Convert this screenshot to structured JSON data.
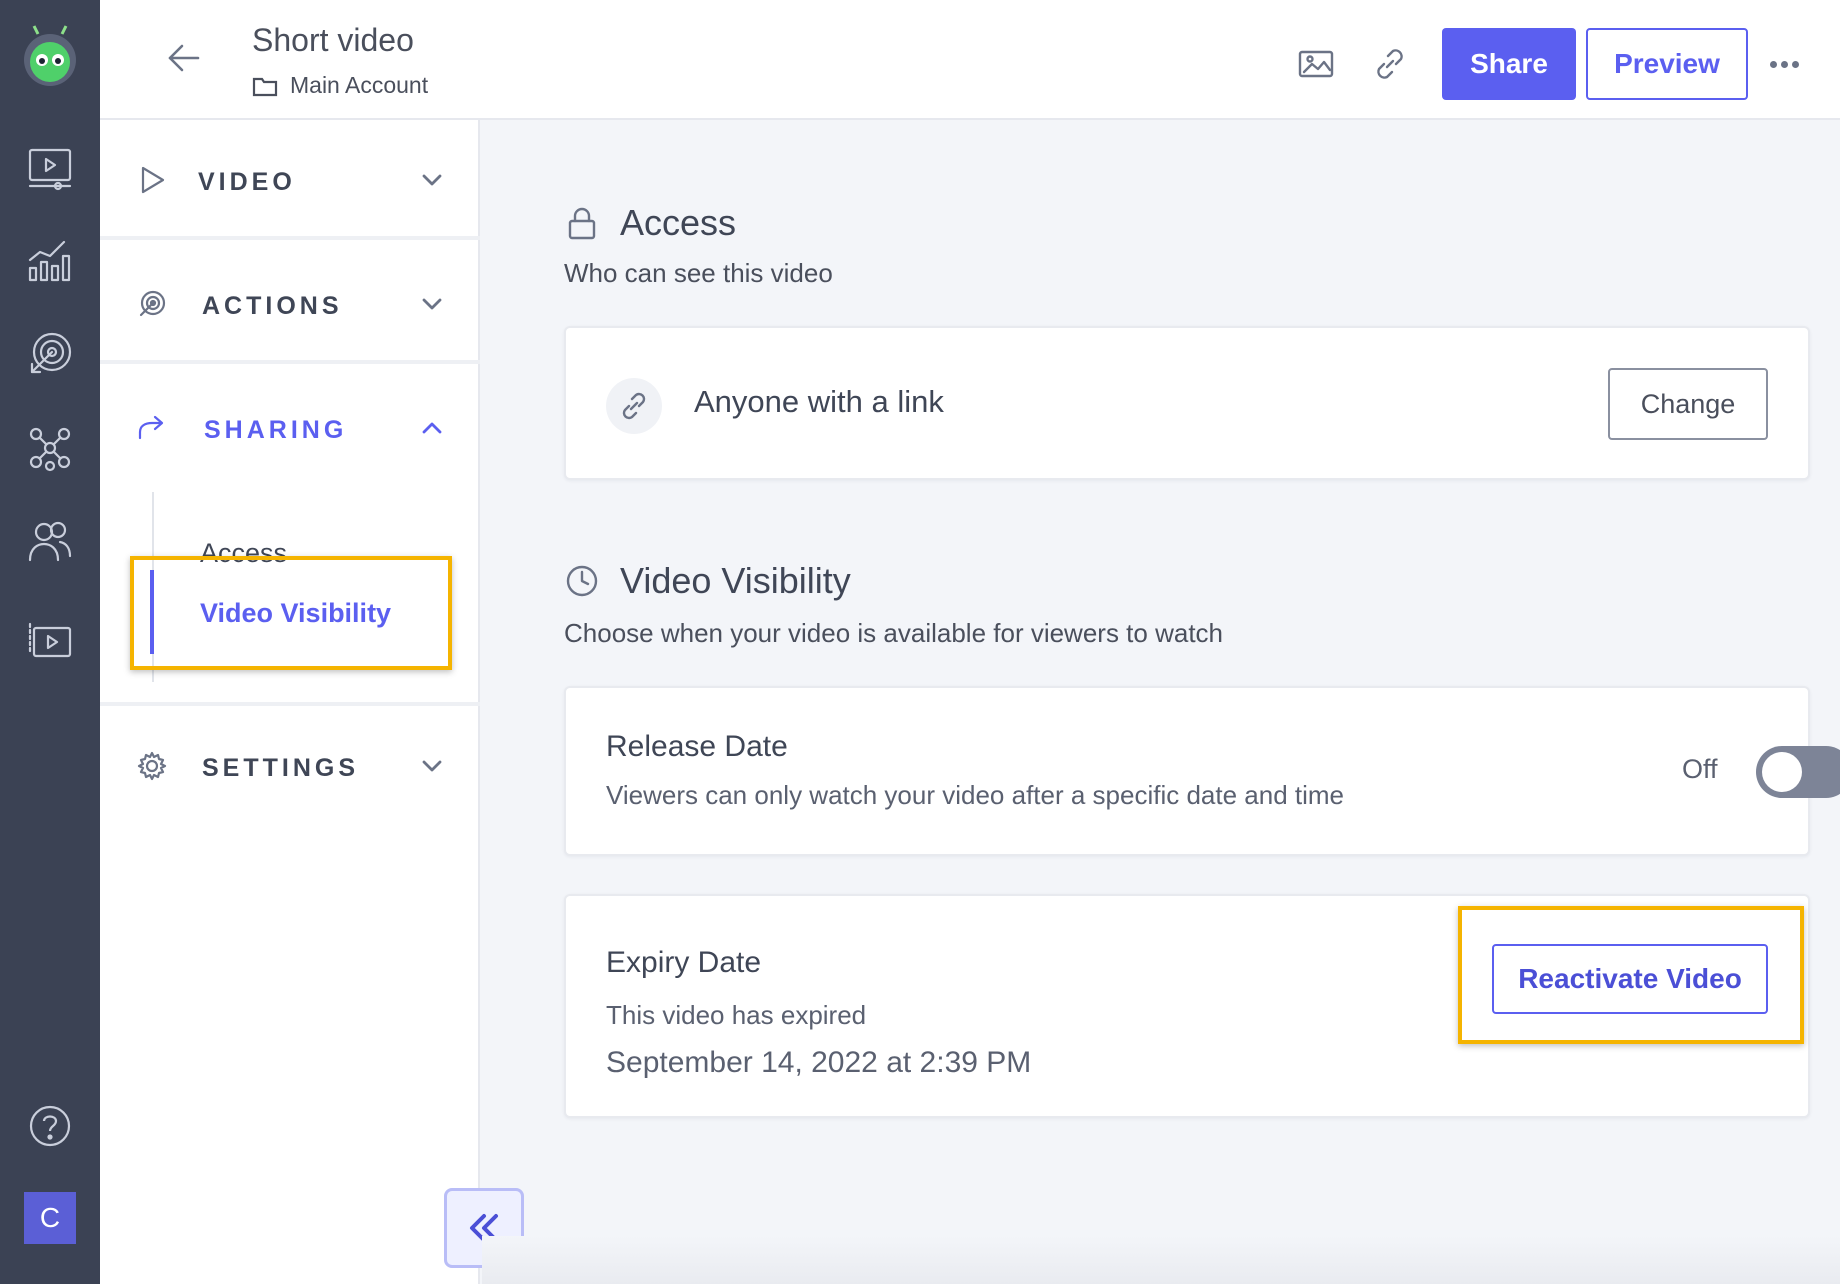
{
  "header": {
    "title": "Short video",
    "breadcrumb": "Main Account",
    "share_label": "Share",
    "preview_label": "Preview"
  },
  "rail": {
    "avatar_initial": "C",
    "icons": [
      "videos-icon",
      "analytics-icon",
      "target-icon",
      "integrations-icon",
      "contacts-icon",
      "playlists-icon",
      "help-icon"
    ]
  },
  "sidenav": {
    "sections": [
      {
        "label": "VIDEO",
        "icon": "play-icon",
        "expanded": false
      },
      {
        "label": "ACTIONS",
        "icon": "target-icon",
        "expanded": false
      },
      {
        "label": "SHARING",
        "icon": "share-icon",
        "expanded": true
      },
      {
        "label": "SETTINGS",
        "icon": "gear-icon",
        "expanded": false
      }
    ],
    "sharing_items": [
      {
        "label": "Access",
        "active": false
      },
      {
        "label": "Video Visibility",
        "active": true
      }
    ]
  },
  "access": {
    "heading": "Access",
    "subheading": "Who can see this video",
    "setting": "Anyone with a link",
    "change_label": "Change"
  },
  "visibility": {
    "heading": "Video Visibility",
    "subheading": "Choose when your video is available for viewers to watch",
    "release": {
      "title": "Release Date",
      "description": "Viewers can only watch your video after a specific date and time",
      "state_label": "Off",
      "enabled": false
    },
    "expiry": {
      "title": "Expiry Date",
      "status": "This video has expired",
      "datetime": "September 14, 2022 at 2:39 PM",
      "button_label": "Reactivate Video"
    }
  },
  "colors": {
    "accent": "#5b5ff0",
    "rail_bg": "#3b4254",
    "highlight": "#f5b400"
  }
}
